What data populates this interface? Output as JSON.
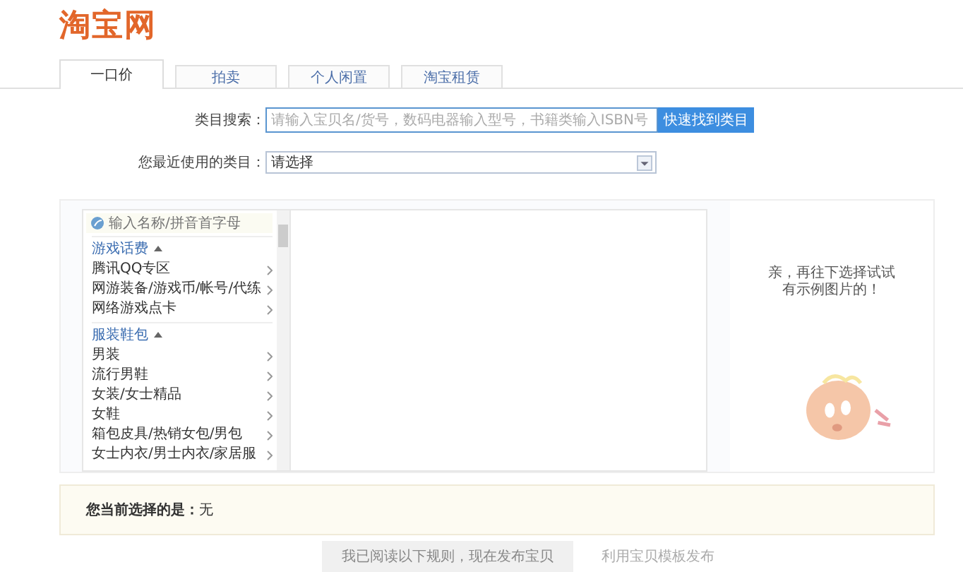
{
  "logo": "淘宝网",
  "tabs": [
    {
      "label": "一口价",
      "selected": true
    },
    {
      "label": "拍卖",
      "selected": false
    },
    {
      "label": "个人闲置",
      "selected": false
    },
    {
      "label": "淘宝租赁",
      "selected": false
    }
  ],
  "category_search": {
    "label": "类目搜索：",
    "placeholder": "请输入宝贝名/货号，数码电器输入型号，书籍类输入ISBN号",
    "button": "快速找到类目"
  },
  "recent": {
    "label": "您最近使用的类目：",
    "value": "请选择"
  },
  "category_list": {
    "placeholder": "输入名称/拼音首字母",
    "groups": [
      {
        "title": "游戏话费",
        "expanded": true,
        "children": [
          {
            "label": "腾讯QQ专区"
          },
          {
            "label": "网游装备/游戏币/帐号/代练"
          },
          {
            "label": "网络游戏点卡"
          }
        ]
      },
      {
        "title": "服装鞋包",
        "expanded": true,
        "children": [
          {
            "label": "男装"
          },
          {
            "label": "流行男鞋"
          },
          {
            "label": "女装/女士精品"
          },
          {
            "label": "女鞋"
          },
          {
            "label": "箱包皮具/热销女包/男包"
          },
          {
            "label": "女士内衣/男士内衣/家居服"
          }
        ]
      }
    ]
  },
  "hint": {
    "lines": [
      "亲，再往下选择试试",
      "有示例图片的！"
    ]
  },
  "selection": {
    "label": "您当前选择的是：",
    "value": "无"
  },
  "publish_button": {
    "label": "我已阅读以下规则，现在发布宝贝",
    "disabled": true
  },
  "template_link": "利用宝贝模板发布"
}
